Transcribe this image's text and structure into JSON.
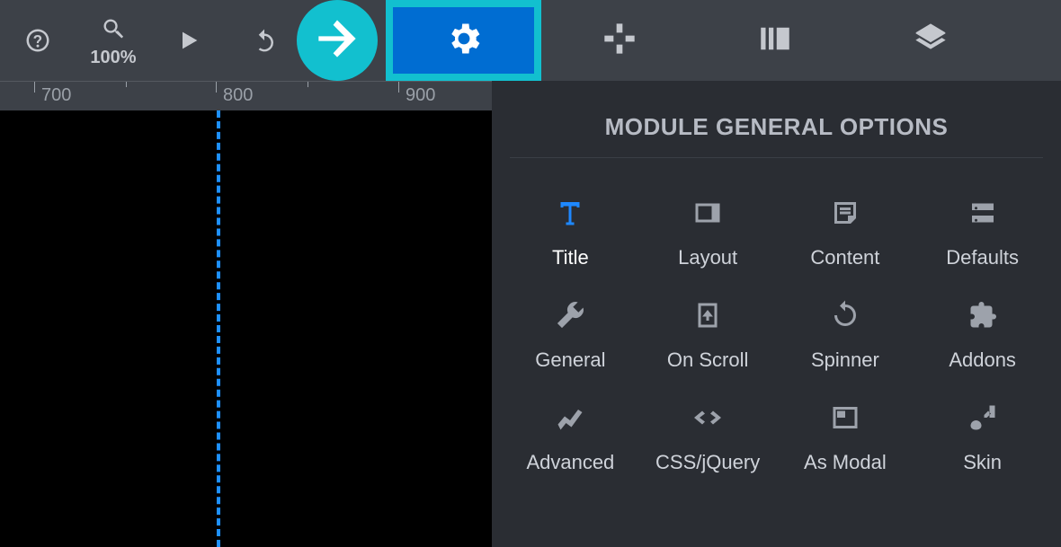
{
  "toolbar": {
    "zoom_label": "100%",
    "tabs": [
      "settings",
      "move",
      "media",
      "layers"
    ],
    "active_tab": 0
  },
  "ruler": {
    "major_ticks": [
      700,
      800,
      900
    ]
  },
  "panel": {
    "title": "MODULE GENERAL OPTIONS",
    "items": [
      {
        "label": "Title",
        "icon": "text",
        "active": true
      },
      {
        "label": "Layout",
        "icon": "layout",
        "active": false
      },
      {
        "label": "Content",
        "icon": "content",
        "active": false
      },
      {
        "label": "Defaults",
        "icon": "defaults",
        "active": false
      },
      {
        "label": "General",
        "icon": "wrench",
        "active": false
      },
      {
        "label": "On Scroll",
        "icon": "download",
        "active": false
      },
      {
        "label": "Spinner",
        "icon": "spinner",
        "active": false
      },
      {
        "label": "Addons",
        "icon": "puzzle",
        "active": false
      },
      {
        "label": "Advanced",
        "icon": "chart",
        "active": false
      },
      {
        "label": "CSS/jQuery",
        "icon": "code",
        "active": false
      },
      {
        "label": "As Modal",
        "icon": "modal",
        "active": false
      },
      {
        "label": "Skin",
        "icon": "brush",
        "active": false
      }
    ]
  },
  "colors": {
    "accent": "#006dd2",
    "highlight": "#12c0cf",
    "guide": "#1e90ff"
  }
}
